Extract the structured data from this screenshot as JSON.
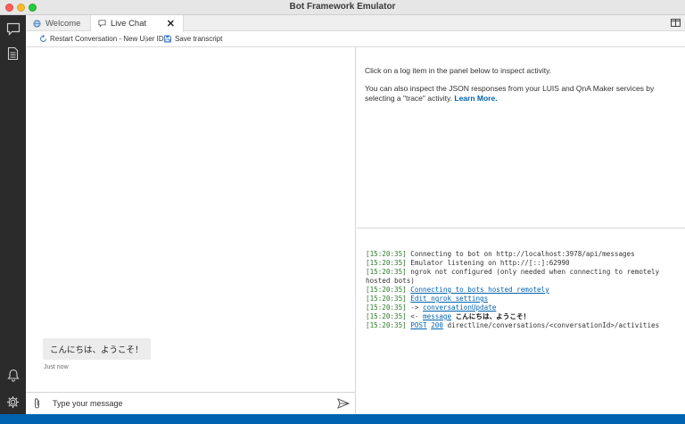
{
  "window": {
    "title": "Bot Framework Emulator"
  },
  "tabs": [
    {
      "label": "Welcome"
    },
    {
      "label": "Live Chat"
    }
  ],
  "toolbar": {
    "restart_label": "Restart Conversation - New User ID",
    "save_label": "Save transcript"
  },
  "chat": {
    "messages": [
      {
        "text": "こんにちは、ようこそ！",
        "timestamp": "Just now"
      }
    ],
    "input_placeholder": "Type your message"
  },
  "inspector": {
    "line1": "Click on a log item in the panel below to inspect activity.",
    "line2": "You can also inspect the JSON responses from your LUIS and QnA Maker services by selecting a \"trace\" activity.",
    "learn_more": "Learn More."
  },
  "log": [
    {
      "time": "[15:20:35]",
      "text": "Connecting to bot on http://localhost:3978/api/messages"
    },
    {
      "time": "[15:20:35]",
      "text": "Emulator listening on http://[::]:62990"
    },
    {
      "time": "[15:20:35]",
      "text": "ngrok not configured (only needed when connecting to remotely hosted bots)"
    },
    {
      "time": "[15:20:35]",
      "link": "Connecting to bots hosted remotely"
    },
    {
      "time": "[15:20:35]",
      "link": "Edit ngrok settings"
    },
    {
      "time": "[15:20:35]",
      "prefix": "->",
      "link": "conversationUpdate"
    },
    {
      "time": "[15:20:35]",
      "prefix": "<-",
      "link": "message",
      "text": "こんにちは、ようこそ！"
    },
    {
      "time": "[15:20:35]",
      "link": "POST",
      "link2": "200",
      "text": "directline/conversations/<conversationId>/activities"
    }
  ],
  "colors": {
    "accent": "#0063b1",
    "nav_bg": "#2b2b2b",
    "timestamp": "#2b7a2b"
  },
  "icons": {
    "nav": [
      "chat-bubble-icon",
      "document-icon",
      "bell-icon",
      "gear-icon"
    ],
    "tabs": [
      "globe-icon",
      "chat-bubble-icon",
      "close-icon",
      "split-view-icon"
    ],
    "toolbar": [
      "restart-icon",
      "chevron-down-icon",
      "save-icon"
    ],
    "input": [
      "paperclip-icon",
      "send-icon"
    ]
  }
}
